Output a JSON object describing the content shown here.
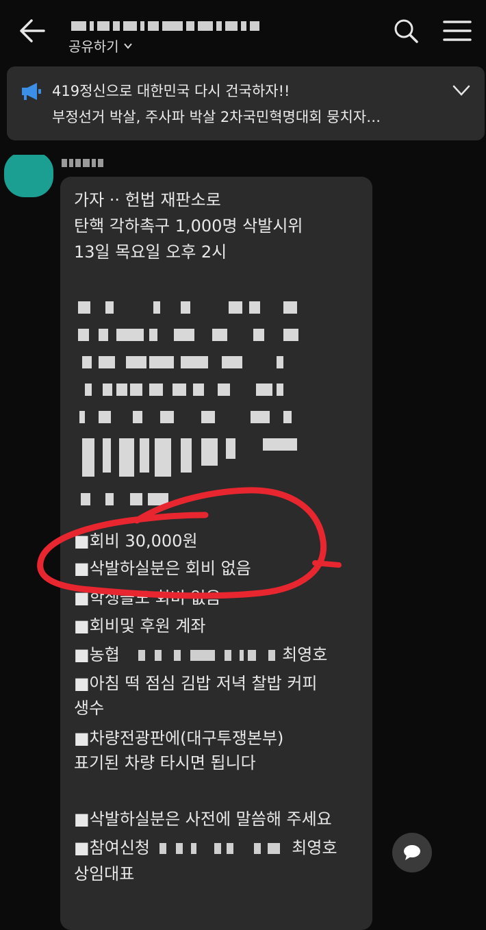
{
  "header": {
    "share_label": "공유하기",
    "icons": [
      "back-arrow-icon",
      "chevron-down-icon",
      "search-icon",
      "hamburger-menu-icon"
    ]
  },
  "notice": {
    "line1": "419정신으로 대한민국 다시 건국하자!!",
    "line2": "부정선거 박살, 주사파 박살 2차국민혁명대회 뭉치자…",
    "icons": [
      "megaphone-icon",
      "chevron-down-icon"
    ]
  },
  "message": {
    "lines": [
      "가자 ·· 헌법 재판소로",
      "탄핵 각하촉구 1,000명 삭발시위",
      "13일 목요일 오후 2시",
      "■회비 30,000원",
      "■삭발하실분은 회비 없음",
      "■학생들도 회비 없음",
      "■회비및 후원 계좌",
      "■농협",
      "최영호",
      "■아침 떡 점심 김밥 저녁 찰밥 커피",
      "생수",
      "■차량전광판에(대구투쟁본부)",
      "표기된 차량 타시면 됩니다",
      "■삭발하실분은 사전에 말씀해 주세요",
      "■참여신청",
      "최영호",
      "상임대표"
    ]
  },
  "colors": {
    "background": "#0b0b0b",
    "bubble": "#2b2b2b",
    "notice": "#2c2c2c",
    "avatar": "#1c9f93",
    "annotation": "#e8262f",
    "megaphone": "#3b8fe6"
  },
  "fab_icon": "chat-bubble-icon"
}
